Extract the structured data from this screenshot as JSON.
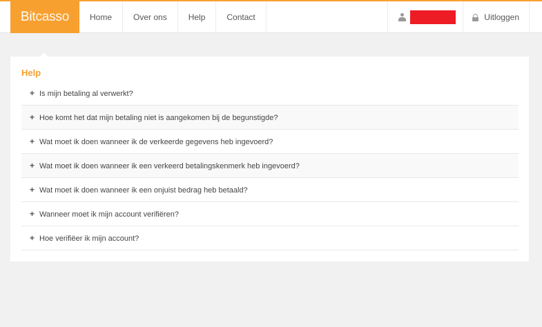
{
  "brand": {
    "part1": "Bit",
    "part2": "casso"
  },
  "nav": [
    {
      "label": "Home"
    },
    {
      "label": "Over ons"
    },
    {
      "label": "Help"
    },
    {
      "label": "Contact"
    }
  ],
  "user": {
    "icon": "user-icon",
    "name_redacted_color": "#ee1c24"
  },
  "logout": {
    "icon": "lock-icon",
    "label": "Uitloggen"
  },
  "help": {
    "title": "Help",
    "expand_icon": "+",
    "questions": [
      {
        "label": "Is mijn betaling al verwerkt?"
      },
      {
        "label": "Hoe komt het dat mijn betaling niet is aangekomen bij de begunstigde?"
      },
      {
        "label": "Wat moet ik doen wanneer ik de verkeerde gegevens heb ingevoerd?"
      },
      {
        "label": "Wat moet ik doen wanneer ik een verkeerd betalingskenmerk heb ingevoerd?"
      },
      {
        "label": "Wat moet ik doen wanneer ik een onjuist bedrag heb betaald?"
      },
      {
        "label": "Wanneer moet ik mijn account verifiëren?"
      },
      {
        "label": "Hoe verifiëer ik mijn account?"
      }
    ]
  },
  "colors": {
    "accent": "#f7a030",
    "background": "#f1f1f1",
    "panel": "#ffffff"
  }
}
